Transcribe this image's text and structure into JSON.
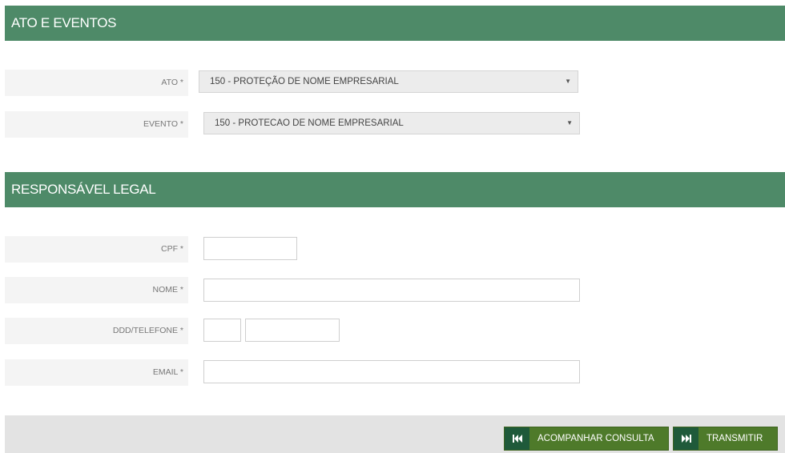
{
  "sections": {
    "ato": {
      "title": "ATO E EVENTOS"
    },
    "responsavel": {
      "title": "RESPONSÁVEL LEGAL"
    }
  },
  "fields": {
    "ato": {
      "label": "ATO *",
      "value": "150 - PROTEÇÃO DE NOME EMPRESARIAL"
    },
    "evento": {
      "label": "EVENTO *",
      "value": "150 - PROTECAO DE NOME EMPRESARIAL"
    },
    "cpf": {
      "label": "CPF *",
      "value": ""
    },
    "nome": {
      "label": "NOME *",
      "value": ""
    },
    "telefone": {
      "label": "DDD/TELEFONE *",
      "ddd": "",
      "numero": ""
    },
    "email": {
      "label": "EMAIL *",
      "value": ""
    }
  },
  "footer": {
    "acompanhar_label": "ACOMPANHAR CONSULTA",
    "transmitir_label": "TRANSMITIR"
  },
  "icons": {
    "acompanhar": "skip-back-icon",
    "transmitir": "skip-forward-icon",
    "dropdown": "dropdown-arrow-icon"
  },
  "colors": {
    "header_bg": "#4e8a68",
    "button_bg": "#4e7a2a",
    "button_icon_bg": "#1f5a3a"
  }
}
